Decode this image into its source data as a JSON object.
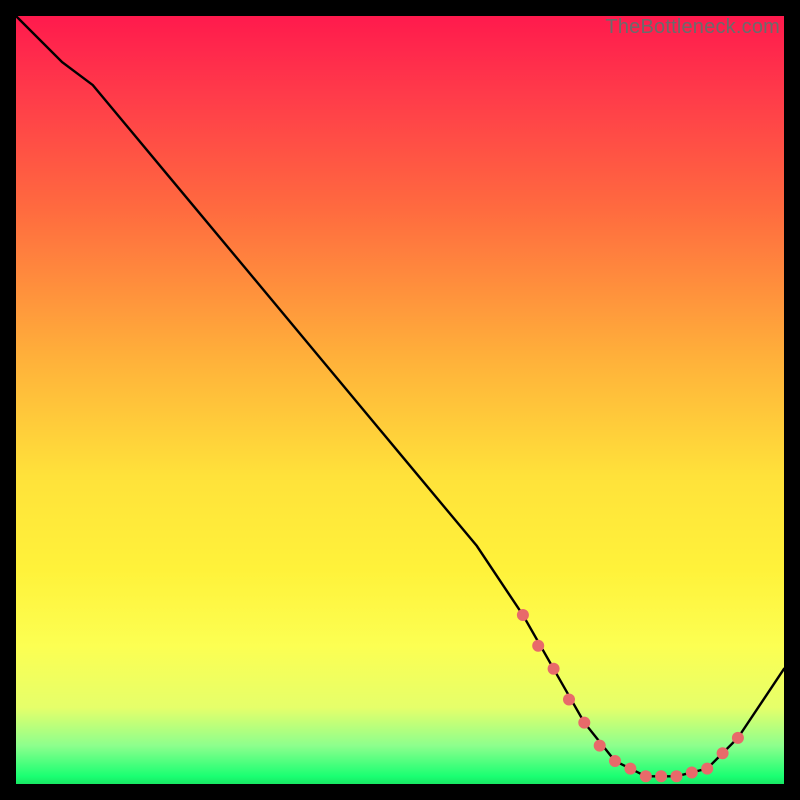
{
  "watermark": "TheBottleneck.com",
  "chart_data": {
    "type": "line",
    "title": "",
    "xlabel": "",
    "ylabel": "",
    "xlim": [
      0,
      100
    ],
    "ylim": [
      0,
      100
    ],
    "background": "rainbow-gradient-vertical",
    "series": [
      {
        "name": "bottleneck-curve",
        "x": [
          0,
          6,
          10,
          20,
          30,
          40,
          50,
          60,
          66,
          70,
          74,
          78,
          82,
          86,
          90,
          94,
          100
        ],
        "y": [
          100,
          94,
          91,
          79,
          67,
          55,
          43,
          31,
          22,
          15,
          8,
          3,
          1,
          1,
          2,
          6,
          15
        ]
      }
    ],
    "markers": {
      "name": "highlight-dots",
      "color": "#e86a6a",
      "x": [
        66,
        68,
        70,
        72,
        74,
        76,
        78,
        80,
        82,
        84,
        86,
        88,
        90,
        92,
        94
      ],
      "y": [
        22,
        18,
        15,
        11,
        8,
        5,
        3,
        2,
        1,
        1,
        1,
        1.5,
        2,
        4,
        6
      ]
    }
  }
}
